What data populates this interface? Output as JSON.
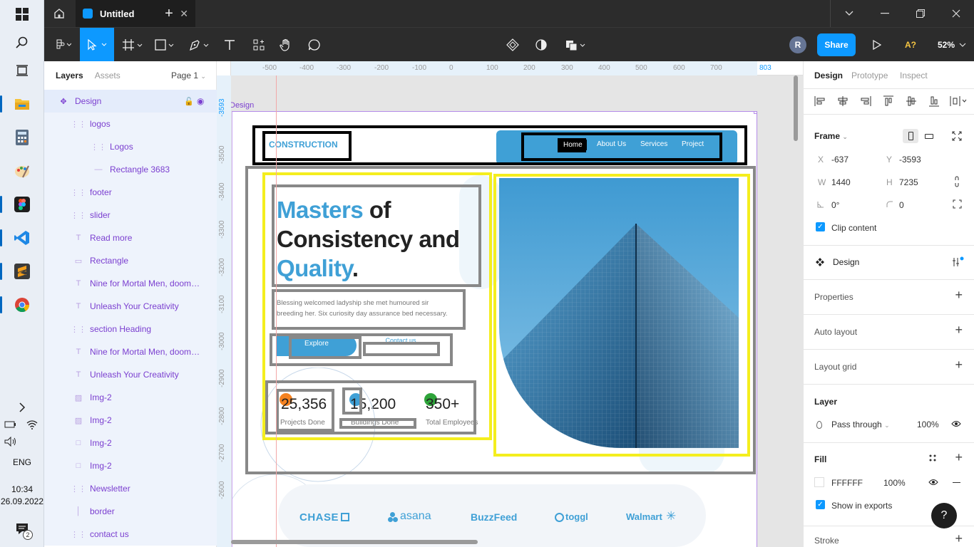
{
  "taskbar": {
    "language": "ENG",
    "time": "10:34",
    "date": "26.09.2022",
    "notification_count": "2"
  },
  "titlebar": {
    "tab_title": "Untitled"
  },
  "toolbar": {
    "avatar_initial": "R",
    "share_label": "Share",
    "a_label": "A?",
    "zoom": "52%"
  },
  "layers_panel": {
    "tabs": [
      "Layers",
      "Assets"
    ],
    "page": "Page 1",
    "items": [
      {
        "name": "Design",
        "icon": "frame",
        "indent": 0
      },
      {
        "name": "logos",
        "icon": "group",
        "indent": 1
      },
      {
        "name": "Logos",
        "icon": "group",
        "indent": 2
      },
      {
        "name": "Rectangle 3683",
        "icon": "line",
        "indent": 2
      },
      {
        "name": "footer",
        "icon": "group",
        "indent": 1
      },
      {
        "name": "slider",
        "icon": "group",
        "indent": 1
      },
      {
        "name": "Read more",
        "icon": "text",
        "indent": 1
      },
      {
        "name": "Rectangle",
        "icon": "rect",
        "indent": 1
      },
      {
        "name": "Nine for Mortal Men, doomed ...",
        "icon": "text",
        "indent": 1
      },
      {
        "name": "Unleash Your Creativity",
        "icon": "text",
        "indent": 1
      },
      {
        "name": "section Heading",
        "icon": "group",
        "indent": 1
      },
      {
        "name": "Nine for Mortal Men, doomed ...",
        "icon": "text",
        "indent": 1
      },
      {
        "name": "Unleash Your Creativity",
        "icon": "text",
        "indent": 1
      },
      {
        "name": "Img-2",
        "icon": "image",
        "indent": 1
      },
      {
        "name": "Img-2",
        "icon": "image",
        "indent": 1
      },
      {
        "name": "Img-2",
        "icon": "square",
        "indent": 1
      },
      {
        "name": "Img-2",
        "icon": "square",
        "indent": 1
      },
      {
        "name": "Newsletter",
        "icon": "group",
        "indent": 1
      },
      {
        "name": "border",
        "icon": "vline",
        "indent": 1
      },
      {
        "name": "contact us",
        "icon": "group",
        "indent": 1
      }
    ]
  },
  "canvas": {
    "ruler_top": [
      "-500",
      "-400",
      "-300",
      "-200",
      "-100",
      "0",
      "100",
      "200",
      "300",
      "400",
      "500",
      "600",
      "700",
      "803"
    ],
    "ruler_left": [
      "-3593",
      "-3500",
      "-3400",
      "-3300",
      "-3200",
      "-3100",
      "-3000",
      "-2900",
      "-2800",
      "-2700",
      "-2600"
    ],
    "frame_label": "Design",
    "site": {
      "logo": "CONSTRUCTION",
      "nav": [
        "Home",
        "About Us",
        "Services",
        "Project"
      ],
      "heading_1": "Masters",
      "heading_2": " of",
      "heading_3": "Consistency and",
      "heading_4": "Quality",
      "heading_5": ".",
      "paragraph_1": "Blessing welcomed ladyship she met humoured sir",
      "paragraph_2": "breeding her. Six curiosity day assurance bed necessary.",
      "explore": "Explore",
      "contact": "Contact us",
      "stats": [
        {
          "value": "25,356",
          "label": "Projects Done"
        },
        {
          "value": "15,200",
          "label": "Buildings Done"
        },
        {
          "value": "350+",
          "label": "Total Employees"
        }
      ],
      "logos": [
        "CHASE",
        "asana",
        "BuzzFeed",
        "toggl",
        "Walmart"
      ]
    }
  },
  "props_panel": {
    "tabs": [
      "Design",
      "Prototype",
      "Inspect"
    ],
    "frame_label": "Frame",
    "x_label": "X",
    "x": "-637",
    "y_label": "Y",
    "y": "-3593",
    "w_label": "W",
    "w": "1440",
    "h_label": "H",
    "h": "7235",
    "rotation": "0°",
    "radius": "0",
    "clip_content": "Clip content",
    "component_name": "Design",
    "sections": [
      "Properties",
      "Auto layout",
      "Layout grid"
    ],
    "layer_label": "Layer",
    "blend": "Pass through",
    "layer_opacity": "100%",
    "fill_label": "Fill",
    "fill_hex": "FFFFFF",
    "fill_opacity": "100%",
    "show_exports": "Show in exports",
    "stroke_label": "Stroke",
    "help": "?"
  },
  "colors": {
    "accent": "#0d99ff",
    "purple": "#7b3fd0",
    "site_blue": "#3fa0d6",
    "highlight_yellow": "#f4ee1e"
  }
}
